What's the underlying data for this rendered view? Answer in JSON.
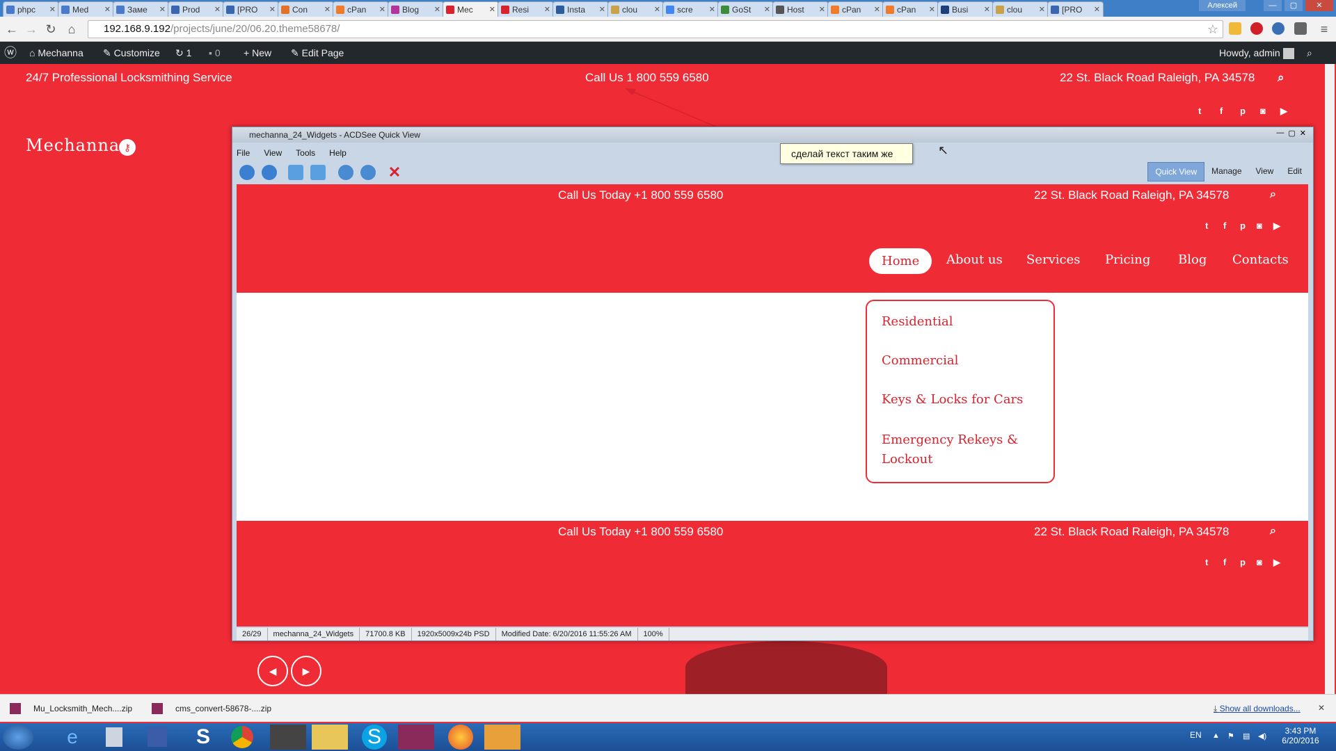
{
  "browser": {
    "tabs": [
      "phpс",
      "Med",
      "Заме",
      "Prod",
      "[PRO",
      "Con",
      "cPan",
      "Blog",
      "Mec",
      "Resi",
      "Insta",
      "clou",
      "scre",
      "GoSt",
      "Host",
      "cPan",
      "cPan",
      "Busi",
      "clou",
      "[PRO"
    ],
    "user_chip": "Алексей",
    "url_host": "192.168.9.192",
    "url_path": "/projects/june/20/06.20.theme58678/"
  },
  "wp_admin": {
    "site_name": "Mechanna",
    "customize": "Customize",
    "updates": "1",
    "comments": "0",
    "new": "New",
    "edit_page": "Edit Page",
    "howdy": "Howdy, admin"
  },
  "site": {
    "tagline": "24/7 Professional Locksmithing Service",
    "phone": "Call Us 1 800 559 6580",
    "address": "22 St. Black Road Raleigh, PA 34578",
    "logo": "Mechanna"
  },
  "acdsee": {
    "title": "mechanna_24_Widgets - ACDSee Quick View",
    "menu": [
      "File",
      "View",
      "Tools",
      "Help"
    ],
    "modes": [
      "Quick View",
      "Manage",
      "View",
      "Edit"
    ],
    "preview": {
      "phone": "Call Us Today +1 800 559 6580",
      "address": "22 St. Black Road  Raleigh, PA 34578",
      "nav": [
        "Home",
        "About us",
        "Services",
        "Pricing",
        "Blog",
        "Contacts"
      ],
      "submenu": [
        "Residential",
        "Commercial",
        "Keys & Locks for Cars",
        "Emergency Rekeys & Lockout"
      ]
    },
    "status": [
      "26/29",
      "mechanna_24_Widgets",
      "71700.8 KB",
      "1920x5009x24b PSD",
      "Modified Date: 6/20/2016 11:55:26 AM",
      "100%"
    ]
  },
  "callout_text": "сделай текст таким же",
  "downloads": {
    "items": [
      "Mu_Locksmith_Mech....zip",
      "cms_convert-58678-....zip"
    ],
    "show_all": "Show all downloads..."
  },
  "taskbar": {
    "lang": "EN",
    "time": "3:43 PM",
    "date": "6/20/2016"
  },
  "colors": {
    "brand_red": "#ef2b36",
    "wp_bar": "#23282d"
  }
}
